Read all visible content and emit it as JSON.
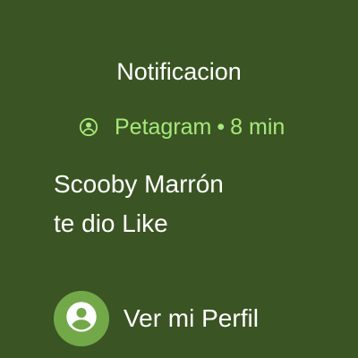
{
  "notification": {
    "title": "Notificacion",
    "app_name": "Petagram",
    "separator": "•",
    "time_ago": "8 min",
    "app_icon": "account-circle-icon",
    "message_line1": "Scooby Marrón",
    "message_line2": "te dio Like"
  },
  "action": {
    "label": "Ver mi Perfil",
    "icon": "account-circle-icon"
  },
  "colors": {
    "background": "#3a5423",
    "accent_text": "#a6e87a",
    "action_circle": "#73a849",
    "text": "#ffffff"
  }
}
